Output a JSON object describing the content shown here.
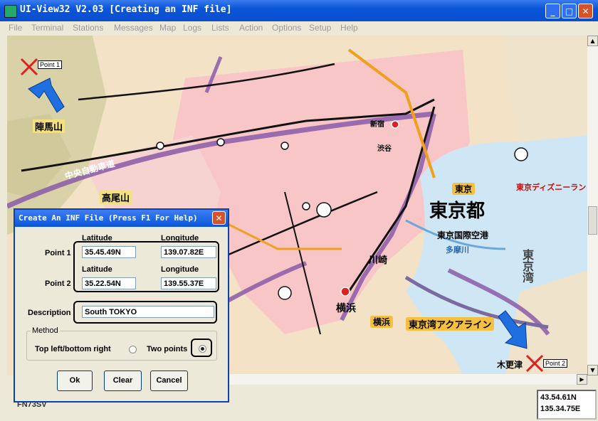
{
  "window": {
    "title": "UI-View32 V2.03 [Creating an INF file]",
    "buttons": {
      "minimize": "_",
      "maximize": "□",
      "close": "✕"
    }
  },
  "menu": [
    "File",
    "Terminal",
    "Stations",
    "Messages",
    "Map",
    "Logs",
    "Lists",
    "Action",
    "Options",
    "Setup",
    "Help"
  ],
  "map": {
    "labels": {
      "tokyo_to": "東京都",
      "tokyo_bay": "東京湾",
      "kawasaki": "川崎",
      "yokohama": "横浜",
      "tokyo": "東京",
      "jinbayama": "陣馬山",
      "takaosan": "高尾山",
      "chuo_expwy": "中央自動車道",
      "aqualine": "東京湾アクアライン",
      "haneda": "東京国際空港",
      "tama_river": "多摩川",
      "disneyland": "東京ディズニーラン",
      "kisarazu": "木更津",
      "shinjuku": "新宿",
      "shibuya": "渋谷"
    },
    "point1_tag": "Point 1",
    "point2_tag": "Point 2"
  },
  "status": {
    "callsign": "FN73SV",
    "lat": "43.54.61N",
    "lon": "135.34.75E"
  },
  "dialog": {
    "title": "Create An INF File (Press F1 For Help)",
    "close": "✕",
    "latitude_label": "Latitude",
    "longitude_label": "Longitude",
    "point1_label": "Point 1",
    "point2_label": "Point 2",
    "point1_lat": "35.45.49N",
    "point1_lon": "139.07.82E",
    "point2_lat": "35.22.54N",
    "point2_lon": "139.55.37E",
    "description_label": "Description",
    "description": "South TOKYO",
    "method_label": "Method",
    "method_option1": "Top left/bottom right",
    "method_option2": "Two points",
    "method_selected": "Two points",
    "ok": "Ok",
    "clear": "Clear",
    "cancel": "Cancel"
  },
  "colors": {
    "titlebar": "#0a55d8",
    "urban": "#f8c6c6",
    "sea": "#cfe6f5",
    "land": "#f3e2c6",
    "expressway": "#8a5aa8",
    "arrow": "#1f6fe0",
    "marker": "#e02020"
  }
}
